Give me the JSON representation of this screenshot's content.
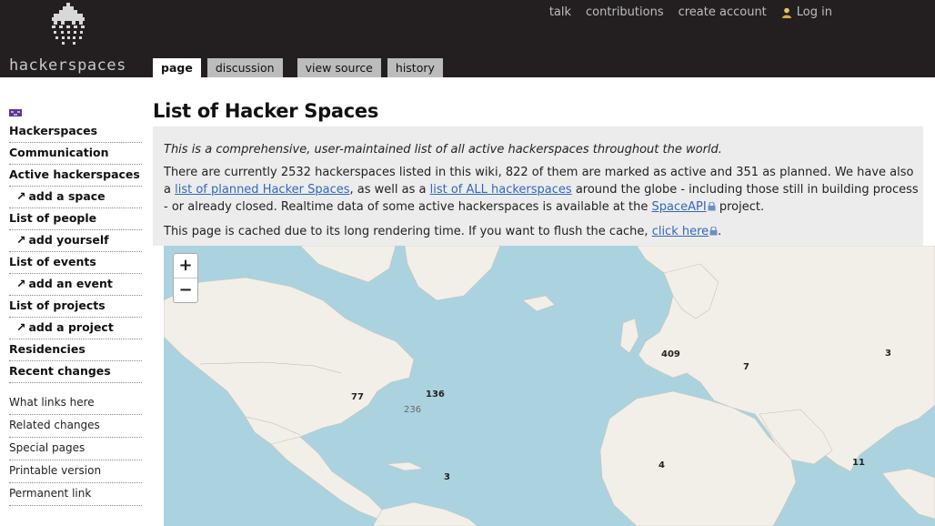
{
  "header": {
    "logo_text": "hackerspaces",
    "personal": {
      "talk": "talk",
      "contributions": "contributions",
      "create_account": "create account",
      "login": "Log in"
    },
    "tabs": {
      "page": "page",
      "discussion": "discussion",
      "view_source": "view source",
      "history": "history"
    }
  },
  "sidebar": {
    "nav": [
      {
        "label": "Hackerspaces"
      },
      {
        "label": "Communication"
      },
      {
        "label": "Active hackerspaces"
      },
      {
        "label": "add a space",
        "sub": true
      },
      {
        "label": "List of people"
      },
      {
        "label": "add yourself",
        "sub": true
      },
      {
        "label": "List of events"
      },
      {
        "label": "add an event",
        "sub": true
      },
      {
        "label": "List of projects"
      },
      {
        "label": "add a project",
        "sub": true
      },
      {
        "label": "Residencies"
      },
      {
        "label": "Recent changes"
      }
    ],
    "arrow": "↗",
    "tools": [
      "What links here",
      "Related changes",
      "Special pages",
      "Printable version",
      "Permanent link"
    ]
  },
  "content": {
    "title": "List of Hacker Spaces",
    "intro": "This is a comprehensive, user-maintained list of all active hackerspaces throughout the world.",
    "p2_a": "There are currently 2532 hackerspaces listed in this wiki, 822 of them are marked as active and 351 as planned. We have also a ",
    "p2_link1": "list of planned Hacker Spaces",
    "p2_b": ", as well as a ",
    "p2_link2": "list of ALL hackerspaces",
    "p2_c": " around the globe - including those still in building process - or already closed. Realtime data of some active hackerspaces is available at the ",
    "p2_link3": "SpaceAPI",
    "p2_d": " project.",
    "p3_a": "This page is cached due to its long rendering time. If you want to flush the cache, ",
    "p3_link": "click here",
    "p3_b": "."
  },
  "map": {
    "zoom_in": "+",
    "zoom_out": "−",
    "clusters": {
      "europe": "409",
      "east_europe": "7",
      "asia_east": "3",
      "us_west": "77",
      "us_east": "136",
      "us_mid": "236",
      "central_america": "3",
      "africa_west": "4",
      "india": "11"
    },
    "colors": {
      "water": "#aad3df",
      "land": "#f2efe9"
    }
  }
}
